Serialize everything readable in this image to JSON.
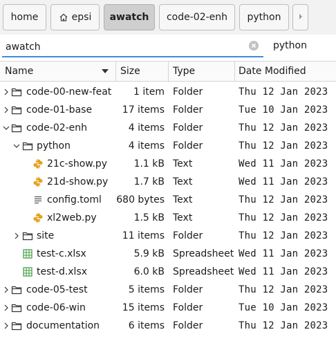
{
  "pathbar": {
    "crumbs": [
      {
        "label": "home"
      },
      {
        "label": "epsi"
      },
      {
        "label": "awatch"
      },
      {
        "label": "code-02-enh"
      },
      {
        "label": "python"
      }
    ]
  },
  "location": {
    "value": "awatch",
    "suffix": "python"
  },
  "columns": {
    "name": "Name",
    "size": "Size",
    "type": "Type",
    "date": "Date Modified"
  },
  "rows": [
    {
      "name": "code-00-new-feat",
      "size": "1 item",
      "type": "Folder",
      "date": "Thu 12 Jan 2023",
      "icon": "folder-icon"
    },
    {
      "name": "code-01-base",
      "size": "17 items",
      "type": "Folder",
      "date": "Tue 10 Jan 2023",
      "icon": "folder-icon"
    },
    {
      "name": "code-02-enh",
      "size": "4 items",
      "type": "Folder",
      "date": "Thu 12 Jan 2023",
      "icon": "folder-icon"
    },
    {
      "name": "python",
      "size": "4 items",
      "type": "Folder",
      "date": "Thu 12 Jan 2023",
      "icon": "folder-icon"
    },
    {
      "name": "21c-show.py",
      "size": "1.1 kB",
      "type": "Text",
      "date": "Wed 11 Jan 2023",
      "icon": "python-file-icon"
    },
    {
      "name": "21d-show.py",
      "size": "1.7 kB",
      "type": "Text",
      "date": "Wed 11 Jan 2023",
      "icon": "python-file-icon"
    },
    {
      "name": "config.toml",
      "size": "680 bytes",
      "type": "Text",
      "date": "Thu 12 Jan 2023",
      "icon": "text-file-icon"
    },
    {
      "name": "xl2web.py",
      "size": "1.5 kB",
      "type": "Text",
      "date": "Thu 12 Jan 2023",
      "icon": "python-file-icon"
    },
    {
      "name": "site",
      "size": "11 items",
      "type": "Folder",
      "date": "Thu 12 Jan 2023",
      "icon": "folder-icon"
    },
    {
      "name": "test-c.xlsx",
      "size": "5.9 kB",
      "type": "Spreadsheet",
      "date": "Wed 11 Jan 2023",
      "icon": "spreadsheet-file-icon"
    },
    {
      "name": "test-d.xlsx",
      "size": "6.0 kB",
      "type": "Spreadsheet",
      "date": "Wed 11 Jan 2023",
      "icon": "spreadsheet-file-icon"
    },
    {
      "name": "code-05-test",
      "size": "5 items",
      "type": "Folder",
      "date": "Thu 12 Jan 2023",
      "icon": "folder-icon"
    },
    {
      "name": "code-06-win",
      "size": "15 items",
      "type": "Folder",
      "date": "Tue 10 Jan 2023",
      "icon": "folder-icon"
    },
    {
      "name": "documentation",
      "size": "6 items",
      "type": "Folder",
      "date": "Thu 12 Jan 2023",
      "icon": "folder-icon"
    }
  ],
  "colors": {
    "accent": "#3a8be0",
    "python_icon": "#e6a019",
    "spreadsheet_icon": "#3c9a3c"
  }
}
